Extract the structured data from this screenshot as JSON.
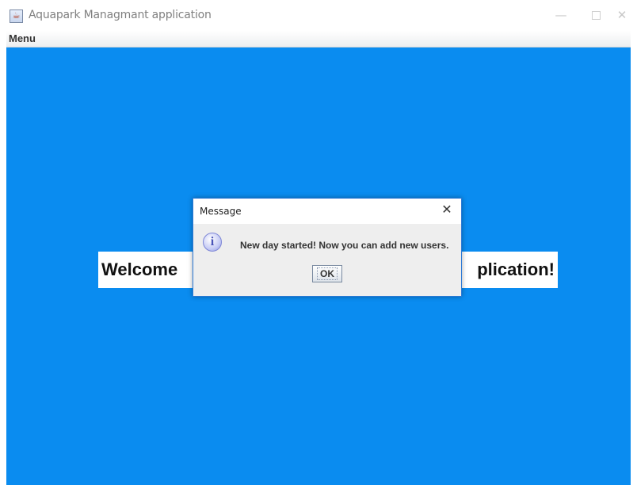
{
  "window": {
    "title": "Aquapark Managmant application",
    "icon": "java-cup-icon",
    "controls": {
      "minimize": "—",
      "close": "✕"
    }
  },
  "menubar": {
    "items": [
      {
        "label": "Menu"
      }
    ]
  },
  "content": {
    "background_color": "#0a8cf0",
    "welcome_left": "Welcome",
    "welcome_right": "plication!"
  },
  "dialog": {
    "title": "Message",
    "close_glyph": "✕",
    "icon": "info-icon",
    "message": "New day started! Now you can add new users.",
    "ok_label": "OK"
  }
}
